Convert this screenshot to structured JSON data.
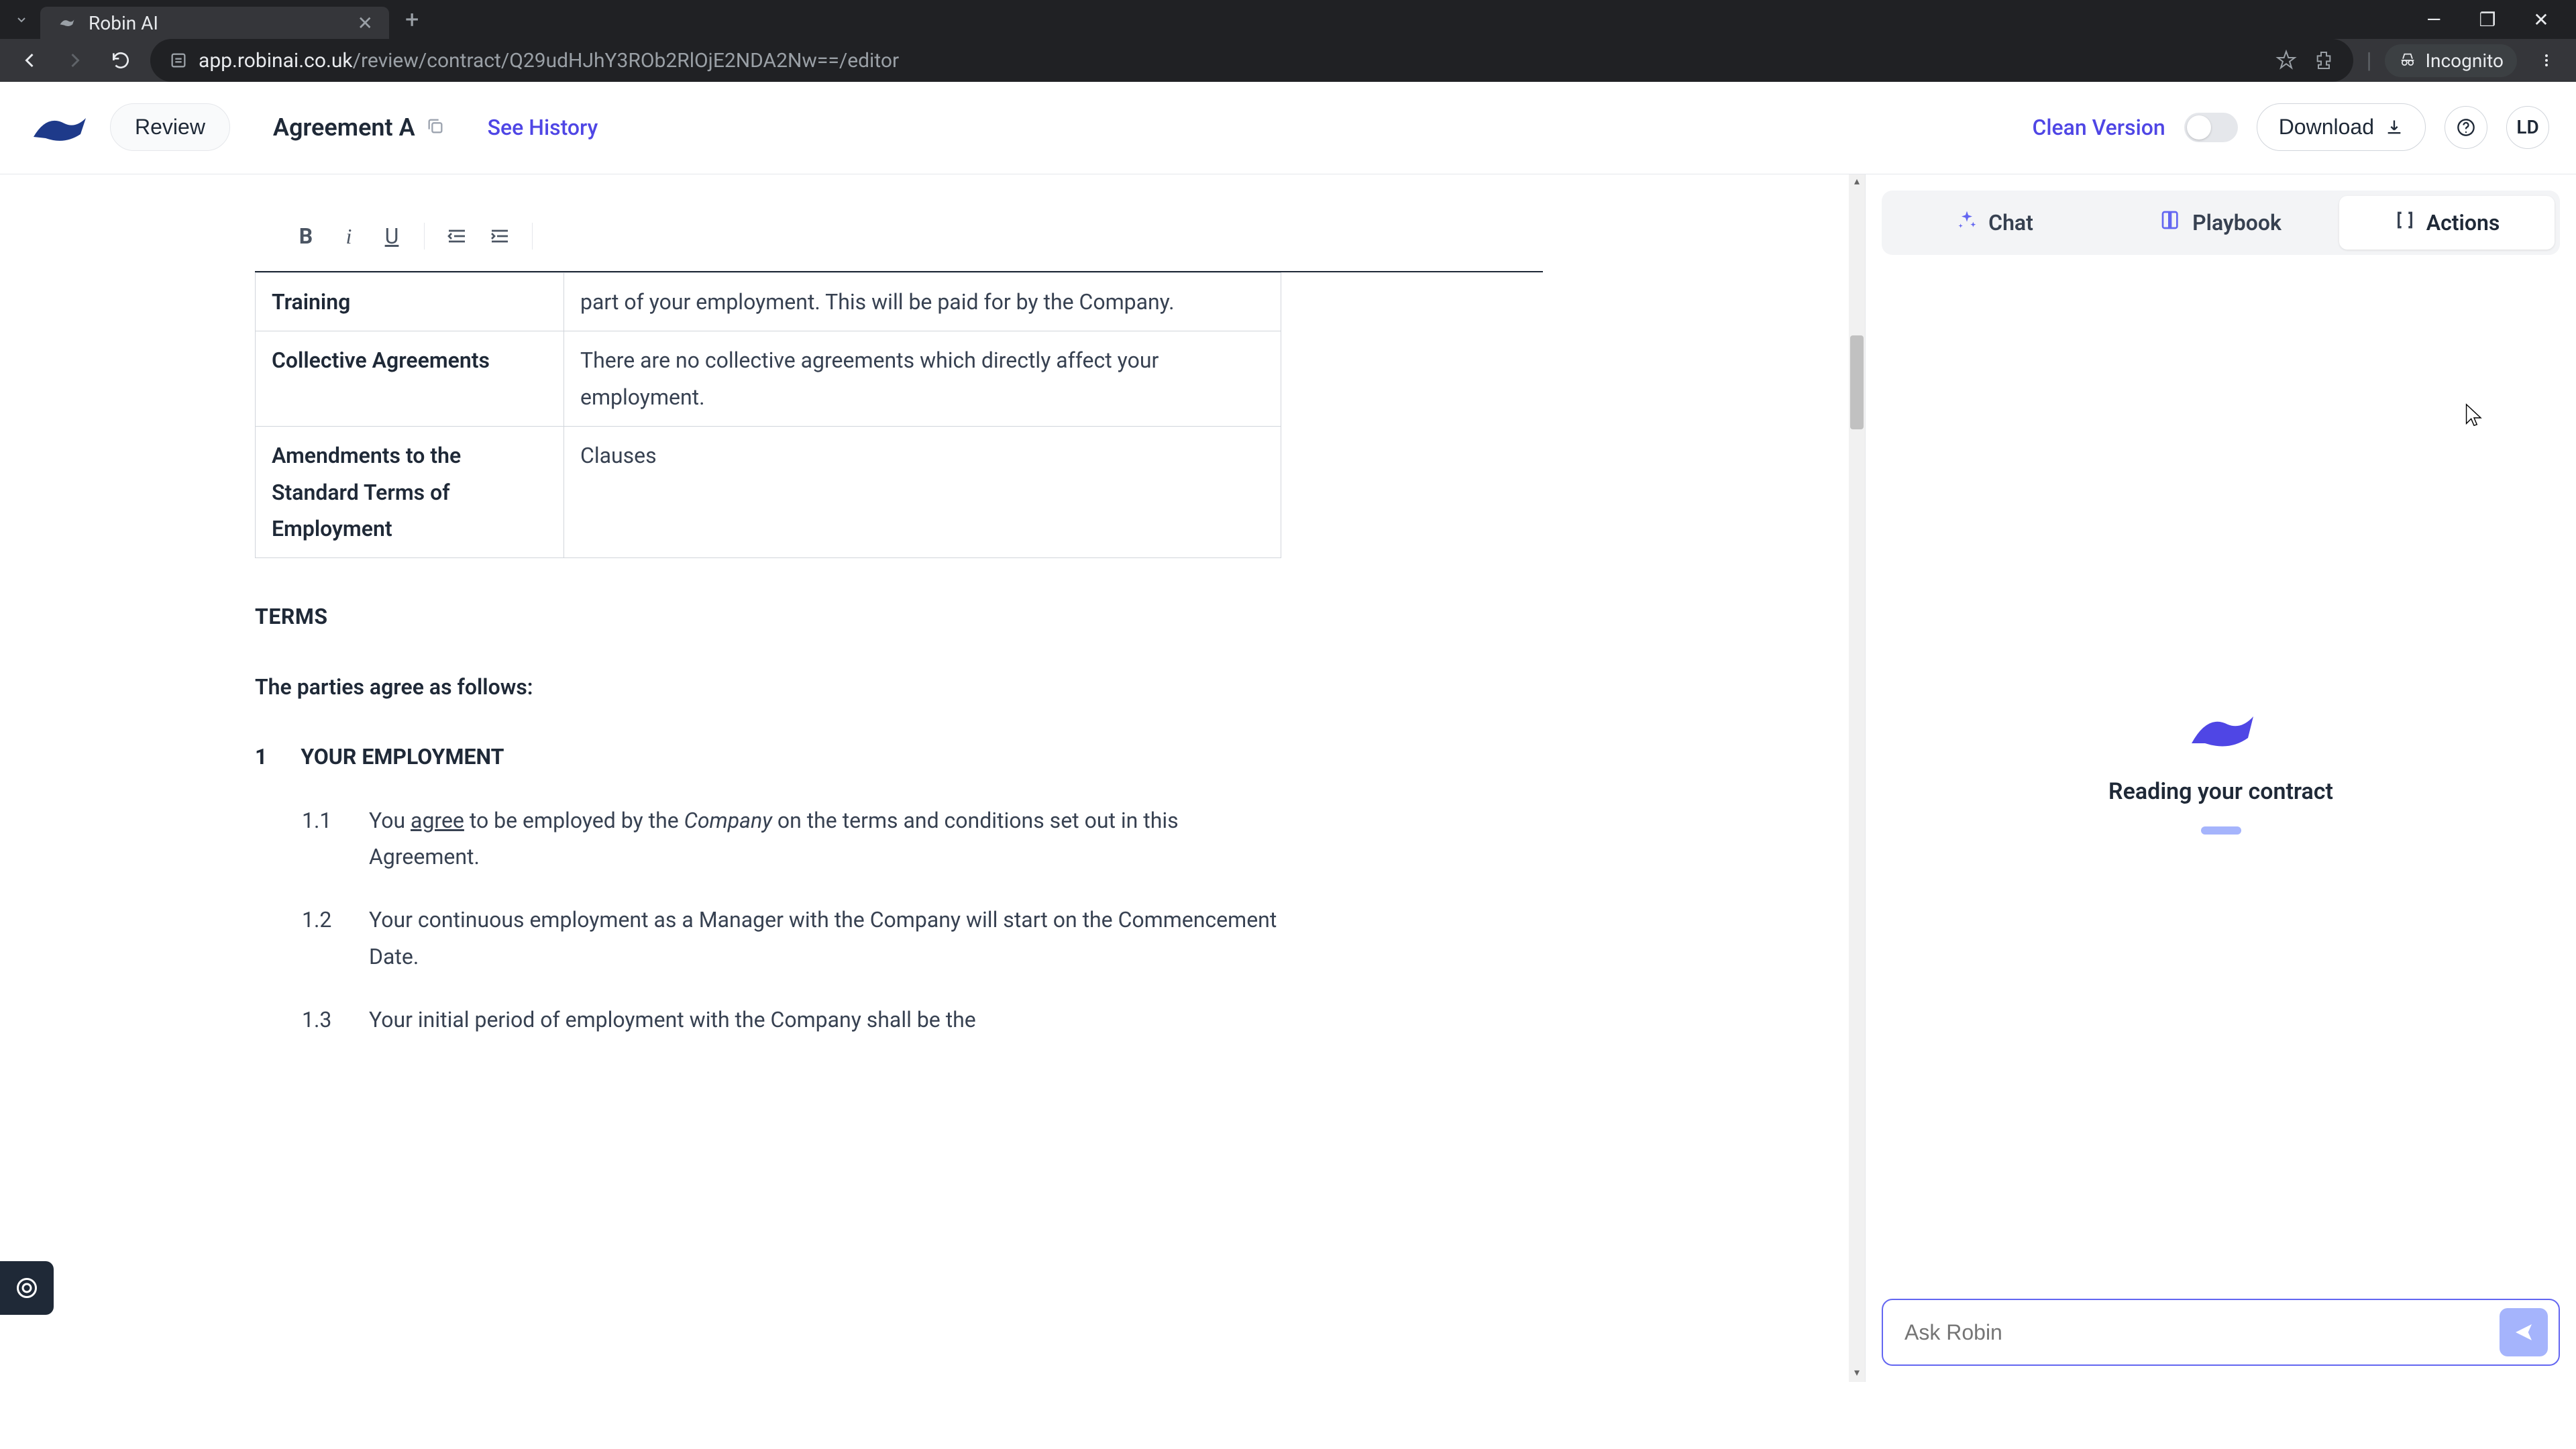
{
  "browser": {
    "tab_title": "Robin AI",
    "url_domain": "app.robinai.co.uk",
    "url_path": "/review/contract/Q29udHJhY3ROb2RlOjE2NDA2Nw==/editor",
    "incognito_label": "Incognito"
  },
  "header": {
    "review_btn": "Review",
    "doc_title": "Agreement A",
    "history_link": "See History",
    "clean_version": "Clean Version",
    "download": "Download",
    "avatar": "LD"
  },
  "document": {
    "table_rows": [
      {
        "label": "Training",
        "value": "part of your employment. This will be paid for by the Company."
      },
      {
        "label": "Collective Agreements",
        "value": "There are no collective agreements which directly affect your employment."
      },
      {
        "label": "Amendments to the Standard Terms of Employment",
        "value": "Clauses"
      }
    ],
    "terms_heading": "TERMS",
    "intro": "The parties agree as follows:",
    "section_num": "1",
    "section_title": "YOUR EMPLOYMENT",
    "clauses": [
      {
        "num": "1.1",
        "pre": "You ",
        "u": "agree",
        "mid": " to be employed by the ",
        "i": "Company",
        "post": " on the terms and conditions set out in this Agreement."
      },
      {
        "num": "1.2",
        "text": "Your continuous employment as a Manager with the Company will start on the Commencement Date."
      },
      {
        "num": "1.3",
        "text": "Your initial period of employment with the Company shall be the"
      }
    ]
  },
  "sidebar": {
    "tabs": {
      "chat": "Chat",
      "playbook": "Playbook",
      "actions": "Actions"
    },
    "status": "Reading your contract",
    "input_placeholder": "Ask Robin"
  }
}
